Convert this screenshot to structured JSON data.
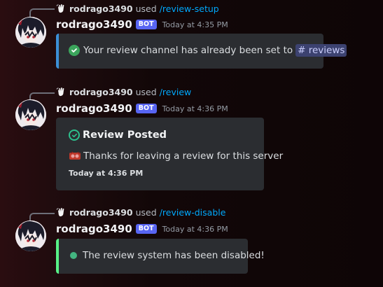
{
  "colors": {
    "accent_blue": "#00a8fc",
    "bot_tag": "#5865f2",
    "embed_bg": "#2b2d31",
    "embed_border_blue": "#3b8fd6",
    "embed_border_gray": "#2b2d31",
    "embed_border_green": "#57f287",
    "success_green": "#3ba55c"
  },
  "messages": [
    {
      "reply_icon": "waving-hand-icon",
      "reply_user": "rodrago3490",
      "reply_verb": "used",
      "reply_command": "/review-setup",
      "author": "rodrago3490",
      "bot_tag": "BOT",
      "timestamp": "Today at 4:35 PM",
      "embed": {
        "icon": "check-circle-icon",
        "text": "Your review channel has already been set to",
        "channel_mention": "# reviews"
      }
    },
    {
      "reply_icon": "waving-hand-icon",
      "reply_user": "rodrago3490",
      "reply_verb": "used",
      "reply_command": "/review",
      "author": "rodrago3490",
      "bot_tag": "BOT",
      "timestamp": "Today at 4:36 PM",
      "embed": {
        "title_icon": "outline-check-circle-icon",
        "title": "Review Posted",
        "desc_icon": "review-sticker-icon",
        "text": "Thanks for leaving a review for this server",
        "footer": "Today at 4:36 PM"
      }
    },
    {
      "reply_icon": "waving-hand-icon",
      "reply_user": "rodrago3490",
      "reply_verb": "used",
      "reply_command": "/review-disable",
      "author": "rodrago3490",
      "bot_tag": "BOT",
      "timestamp": "Today at 4:36 PM",
      "embed": {
        "icon": "green-circle-icon",
        "text": "The review system has been disabled!"
      }
    }
  ]
}
